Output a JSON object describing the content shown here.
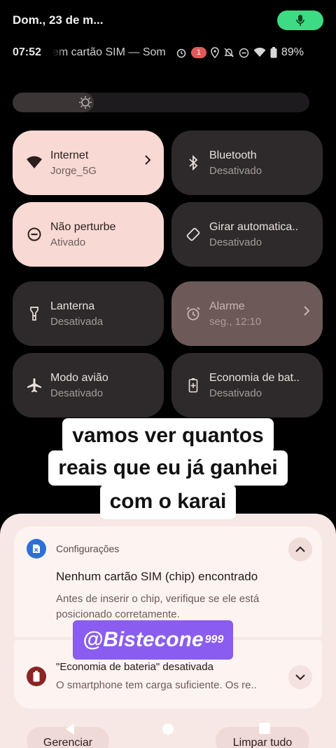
{
  "header": {
    "date": "Dom., 23 de m...",
    "time": "07:52",
    "carrier_status": "em cartão SIM — Som",
    "alarm_badge": "1",
    "battery": "89%",
    "mic_color": "#3ddc84"
  },
  "tiles": [
    {
      "title": "Internet",
      "subtitle": "Jorge_5G",
      "icon": "wifi-icon"
    },
    {
      "title": "Bluetooth",
      "subtitle": "Desativado",
      "icon": "bluetooth-icon"
    },
    {
      "title": "Não perturbe",
      "subtitle": "Ativado",
      "icon": "do-not-disturb-icon"
    },
    {
      "title": "Girar automatica..",
      "subtitle": "Desativado",
      "icon": "rotate-icon"
    },
    {
      "title": "Lanterna",
      "subtitle": "Desativada",
      "icon": "flashlight-icon"
    },
    {
      "title": "Alarme",
      "subtitle": "seg., 12:10",
      "icon": "alarm-icon"
    },
    {
      "title": "Modo avião",
      "subtitle": "Desativado",
      "icon": "airplane-icon"
    },
    {
      "title": "Economia de bat..",
      "subtitle": "Desativado",
      "icon": "battery-saver-icon"
    }
  ],
  "caption": {
    "line1": "vamos ver quantos",
    "line2": "reais que eu já ganhei",
    "line3": "com o karai"
  },
  "notifications": [
    {
      "app": "Configurações",
      "title": "Nenhum cartão SIM (chip) encontrado",
      "body": "Antes de inserir o chip, verifique se ele está posicionado corretamente."
    },
    {
      "title": "\"Economia de bateria\" desativada",
      "body": "O smartphone tem carga suficiente. Os re.."
    }
  ],
  "watermark": {
    "handle": "@Bistecone",
    "suffix": "999"
  },
  "actions": {
    "manage": "Gerenciar",
    "clear_all": "Limpar tudo"
  },
  "colors": {
    "tile_on": "#f8d9d4",
    "tile_off": "#2e2a2b",
    "panel": "#f7e7e5"
  }
}
